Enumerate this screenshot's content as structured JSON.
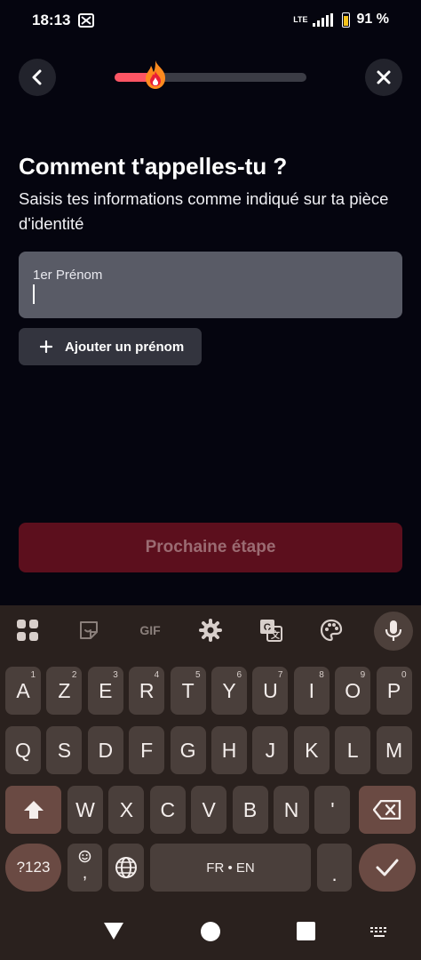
{
  "status_bar": {
    "time": "18:13",
    "network": "LTE",
    "battery": "91 %"
  },
  "header": {
    "progress_fraction": 0.21,
    "accent_color": "#fd5564"
  },
  "page": {
    "title": "Comment t'appelles-tu ?",
    "subtitle": "Saisis tes informations comme indiqué sur ta pièce d'identité"
  },
  "form": {
    "first_name_label": "1er Prénom",
    "first_name_value": "",
    "add_name_button": "Ajouter un prénom",
    "next_button": "Prochaine étape"
  },
  "keyboard": {
    "toolbar": [
      "apps-icon",
      "sticker-icon",
      "GIF",
      "settings-icon",
      "translate-icon",
      "palette-icon",
      "mic-icon"
    ],
    "gif_label": "GIF",
    "row1": [
      {
        "k": "A",
        "h": "1"
      },
      {
        "k": "Z",
        "h": "2"
      },
      {
        "k": "E",
        "h": "3"
      },
      {
        "k": "R",
        "h": "4"
      },
      {
        "k": "T",
        "h": "5"
      },
      {
        "k": "Y",
        "h": "6"
      },
      {
        "k": "U",
        "h": "7"
      },
      {
        "k": "I",
        "h": "8"
      },
      {
        "k": "O",
        "h": "9"
      },
      {
        "k": "P",
        "h": "0"
      }
    ],
    "row2": [
      "Q",
      "S",
      "D",
      "F",
      "G",
      "H",
      "J",
      "K",
      "L",
      "M"
    ],
    "row3": [
      "W",
      "X",
      "C",
      "V",
      "B",
      "N",
      "'"
    ],
    "symbols_key": "?123",
    "emoji_comma_key": ",",
    "space_key": "FR • EN",
    "period_key": "."
  }
}
